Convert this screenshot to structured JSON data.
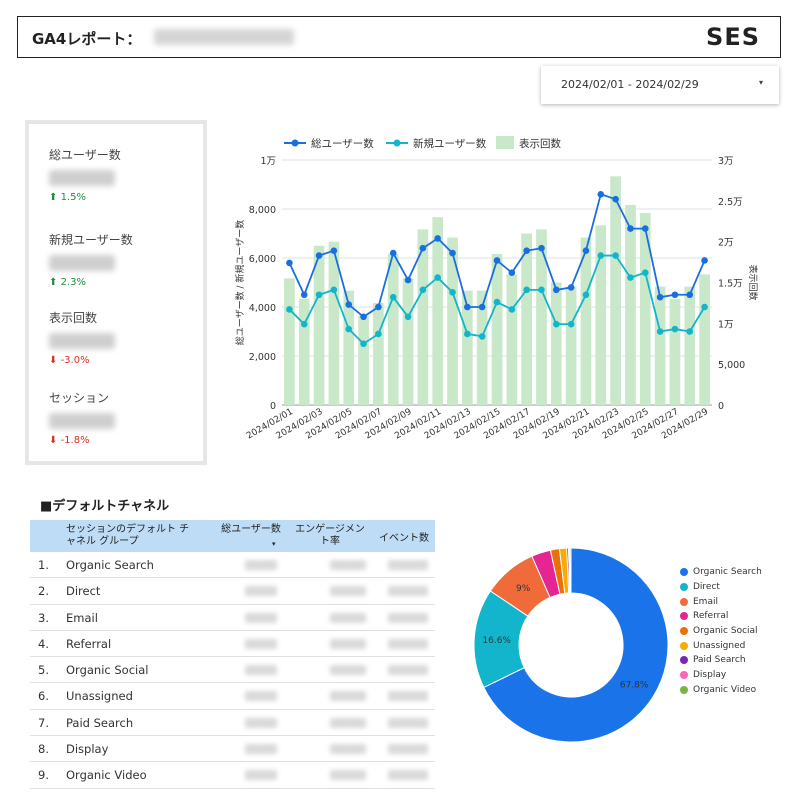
{
  "header": {
    "title": "GA4レポート：",
    "brand": "SES"
  },
  "date_range": {
    "label": "2024/02/01 - 2024/02/29",
    "caret": "▾"
  },
  "metrics": [
    {
      "label": "総ユーザー数",
      "delta": "1.5%",
      "direction": "up"
    },
    {
      "label": "新規ユーザー数",
      "delta": "2.3%",
      "direction": "up"
    },
    {
      "label": "表示回数",
      "delta": "-3.0%",
      "direction": "down"
    },
    {
      "label": "セッション",
      "delta": "-1.8%",
      "direction": "down"
    }
  ],
  "chart_data": [
    {
      "type": "line",
      "legend": [
        "総ユーザー数",
        "新規ユーザー数",
        "表示回数"
      ],
      "x": [
        "2024/02/01",
        "2024/02/02",
        "2024/02/03",
        "2024/02/04",
        "2024/02/05",
        "2024/02/06",
        "2024/02/07",
        "2024/02/08",
        "2024/02/09",
        "2024/02/10",
        "2024/02/11",
        "2024/02/12",
        "2024/02/13",
        "2024/02/14",
        "2024/02/15",
        "2024/02/16",
        "2024/02/17",
        "2024/02/18",
        "2024/02/19",
        "2024/02/20",
        "2024/02/21",
        "2024/02/22",
        "2024/02/23",
        "2024/02/24",
        "2024/02/25",
        "2024/02/26",
        "2024/02/27",
        "2024/02/28",
        "2024/02/29"
      ],
      "x_tick_labels": [
        "2024/02/01",
        "2024/02/03",
        "2024/02/05",
        "2024/02/07",
        "2024/02/09",
        "2024/02/11",
        "2024/02/13",
        "2024/02/15",
        "2024/02/17",
        "2024/02/19",
        "2024/02/21",
        "2024/02/23",
        "2024/02/25",
        "2024/02/27",
        "2024/02/29"
      ],
      "series": [
        {
          "name": "総ユーザー数",
          "axis": "left",
          "color": "#1a6fe0",
          "values": [
            5800,
            4500,
            6100,
            6300,
            4100,
            3600,
            4000,
            6200,
            5100,
            6400,
            6800,
            6200,
            4000,
            4000,
            5900,
            5400,
            6300,
            6400,
            4700,
            4800,
            6300,
            8600,
            8400,
            7200,
            7200,
            4400,
            4500,
            4500,
            5900
          ]
        },
        {
          "name": "新規ユーザー数",
          "axis": "left",
          "color": "#12b5cb",
          "values": [
            3900,
            3300,
            4500,
            4700,
            3100,
            2500,
            2900,
            4400,
            3600,
            4700,
            5200,
            4600,
            2900,
            2800,
            4200,
            3900,
            4700,
            4700,
            3300,
            3300,
            4500,
            6100,
            6100,
            5200,
            5400,
            3000,
            3100,
            3000,
            4000
          ]
        },
        {
          "name": "表示回数",
          "axis": "right",
          "type": "bar",
          "color": "#c9e7c9",
          "values": [
            15500,
            13000,
            19500,
            20000,
            14000,
            11000,
            12500,
            18500,
            15500,
            21500,
            23000,
            20500,
            14000,
            14000,
            18500,
            16000,
            21000,
            21500,
            15000,
            14500,
            20500,
            22000,
            28000,
            24500,
            23500,
            14500,
            13000,
            14500,
            16000
          ]
        }
      ],
      "ylabel": "総ユーザー数 / 新規ユーザー数",
      "y2label": "表示回数",
      "y_ticks": [
        "0",
        "2,000",
        "4,000",
        "6,000",
        "8,000",
        "1万"
      ],
      "y2_ticks": [
        "0",
        "5,000",
        "1万",
        "1.5万",
        "2万",
        "2.5万",
        "3万"
      ],
      "ylim": [
        0,
        10000
      ],
      "y2lim": [
        0,
        30000
      ],
      "grid": true,
      "legend_position": "top"
    },
    {
      "type": "pie",
      "title": "",
      "categories": [
        "Organic Search",
        "Direct",
        "Email",
        "Referral",
        "Organic Social",
        "Unassigned",
        "Paid Search",
        "Display",
        "Organic Video"
      ],
      "values": [
        67.8,
        16.6,
        9.0,
        3.2,
        1.5,
        1.2,
        0.3,
        0.2,
        0.2
      ],
      "slice_labels": [
        "67.8%",
        "16.6%",
        "9%",
        "",
        "",
        "",
        "",
        "",
        ""
      ],
      "colors": [
        "#1a73e8",
        "#12b5cb",
        "#f16a3a",
        "#e52592",
        "#e8710a",
        "#f9ab00",
        "#7627bb",
        "#ff63b8",
        "#7cb342"
      ],
      "legend_position": "right"
    }
  ],
  "table": {
    "section_title": "■デフォルトチャネル",
    "headers": [
      "セッションのデフォルト チャネル グループ",
      "総ユーザー数",
      "エンゲージメント率",
      "イベント数"
    ],
    "sort_icon": "▾",
    "rows": [
      {
        "num": "1.",
        "channel": "Organic Search"
      },
      {
        "num": "2.",
        "channel": "Direct"
      },
      {
        "num": "3.",
        "channel": "Email"
      },
      {
        "num": "4.",
        "channel": "Referral"
      },
      {
        "num": "5.",
        "channel": "Organic Social"
      },
      {
        "num": "6.",
        "channel": "Unassigned"
      },
      {
        "num": "7.",
        "channel": "Paid Search"
      },
      {
        "num": "8.",
        "channel": "Display"
      },
      {
        "num": "9.",
        "channel": "Organic Video"
      }
    ]
  }
}
